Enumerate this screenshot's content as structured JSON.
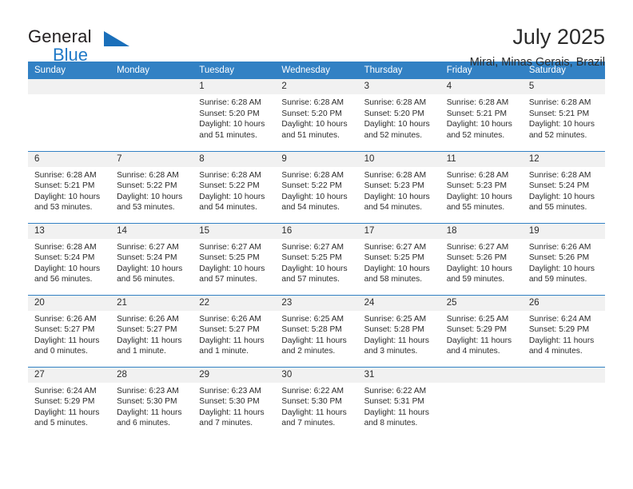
{
  "brand": {
    "name_part1": "General",
    "name_part2": "Blue",
    "triangle_color": "#1a6fba",
    "blue_text_color": "#2079c7"
  },
  "header": {
    "title": "July 2025",
    "subtitle": "Mirai, Minas Gerais, Brazil"
  },
  "theme": {
    "header_blue": "#3281c4",
    "daynum_band": "#f1f1f1",
    "text": "#2b2b2b"
  },
  "calendar": {
    "weekday_headers": [
      "Sunday",
      "Monday",
      "Tuesday",
      "Wednesday",
      "Thursday",
      "Friday",
      "Saturday"
    ],
    "weeks": [
      [
        {
          "day": "",
          "sunrise": "",
          "sunset": "",
          "daylight": ""
        },
        {
          "day": "",
          "sunrise": "",
          "sunset": "",
          "daylight": ""
        },
        {
          "day": "1",
          "sunrise": "Sunrise: 6:28 AM",
          "sunset": "Sunset: 5:20 PM",
          "daylight": "Daylight: 10 hours and 51 minutes."
        },
        {
          "day": "2",
          "sunrise": "Sunrise: 6:28 AM",
          "sunset": "Sunset: 5:20 PM",
          "daylight": "Daylight: 10 hours and 51 minutes."
        },
        {
          "day": "3",
          "sunrise": "Sunrise: 6:28 AM",
          "sunset": "Sunset: 5:20 PM",
          "daylight": "Daylight: 10 hours and 52 minutes."
        },
        {
          "day": "4",
          "sunrise": "Sunrise: 6:28 AM",
          "sunset": "Sunset: 5:21 PM",
          "daylight": "Daylight: 10 hours and 52 minutes."
        },
        {
          "day": "5",
          "sunrise": "Sunrise: 6:28 AM",
          "sunset": "Sunset: 5:21 PM",
          "daylight": "Daylight: 10 hours and 52 minutes."
        }
      ],
      [
        {
          "day": "6",
          "sunrise": "Sunrise: 6:28 AM",
          "sunset": "Sunset: 5:21 PM",
          "daylight": "Daylight: 10 hours and 53 minutes."
        },
        {
          "day": "7",
          "sunrise": "Sunrise: 6:28 AM",
          "sunset": "Sunset: 5:22 PM",
          "daylight": "Daylight: 10 hours and 53 minutes."
        },
        {
          "day": "8",
          "sunrise": "Sunrise: 6:28 AM",
          "sunset": "Sunset: 5:22 PM",
          "daylight": "Daylight: 10 hours and 54 minutes."
        },
        {
          "day": "9",
          "sunrise": "Sunrise: 6:28 AM",
          "sunset": "Sunset: 5:22 PM",
          "daylight": "Daylight: 10 hours and 54 minutes."
        },
        {
          "day": "10",
          "sunrise": "Sunrise: 6:28 AM",
          "sunset": "Sunset: 5:23 PM",
          "daylight": "Daylight: 10 hours and 54 minutes."
        },
        {
          "day": "11",
          "sunrise": "Sunrise: 6:28 AM",
          "sunset": "Sunset: 5:23 PM",
          "daylight": "Daylight: 10 hours and 55 minutes."
        },
        {
          "day": "12",
          "sunrise": "Sunrise: 6:28 AM",
          "sunset": "Sunset: 5:24 PM",
          "daylight": "Daylight: 10 hours and 55 minutes."
        }
      ],
      [
        {
          "day": "13",
          "sunrise": "Sunrise: 6:28 AM",
          "sunset": "Sunset: 5:24 PM",
          "daylight": "Daylight: 10 hours and 56 minutes."
        },
        {
          "day": "14",
          "sunrise": "Sunrise: 6:27 AM",
          "sunset": "Sunset: 5:24 PM",
          "daylight": "Daylight: 10 hours and 56 minutes."
        },
        {
          "day": "15",
          "sunrise": "Sunrise: 6:27 AM",
          "sunset": "Sunset: 5:25 PM",
          "daylight": "Daylight: 10 hours and 57 minutes."
        },
        {
          "day": "16",
          "sunrise": "Sunrise: 6:27 AM",
          "sunset": "Sunset: 5:25 PM",
          "daylight": "Daylight: 10 hours and 57 minutes."
        },
        {
          "day": "17",
          "sunrise": "Sunrise: 6:27 AM",
          "sunset": "Sunset: 5:25 PM",
          "daylight": "Daylight: 10 hours and 58 minutes."
        },
        {
          "day": "18",
          "sunrise": "Sunrise: 6:27 AM",
          "sunset": "Sunset: 5:26 PM",
          "daylight": "Daylight: 10 hours and 59 minutes."
        },
        {
          "day": "19",
          "sunrise": "Sunrise: 6:26 AM",
          "sunset": "Sunset: 5:26 PM",
          "daylight": "Daylight: 10 hours and 59 minutes."
        }
      ],
      [
        {
          "day": "20",
          "sunrise": "Sunrise: 6:26 AM",
          "sunset": "Sunset: 5:27 PM",
          "daylight": "Daylight: 11 hours and 0 minutes."
        },
        {
          "day": "21",
          "sunrise": "Sunrise: 6:26 AM",
          "sunset": "Sunset: 5:27 PM",
          "daylight": "Daylight: 11 hours and 1 minute."
        },
        {
          "day": "22",
          "sunrise": "Sunrise: 6:26 AM",
          "sunset": "Sunset: 5:27 PM",
          "daylight": "Daylight: 11 hours and 1 minute."
        },
        {
          "day": "23",
          "sunrise": "Sunrise: 6:25 AM",
          "sunset": "Sunset: 5:28 PM",
          "daylight": "Daylight: 11 hours and 2 minutes."
        },
        {
          "day": "24",
          "sunrise": "Sunrise: 6:25 AM",
          "sunset": "Sunset: 5:28 PM",
          "daylight": "Daylight: 11 hours and 3 minutes."
        },
        {
          "day": "25",
          "sunrise": "Sunrise: 6:25 AM",
          "sunset": "Sunset: 5:29 PM",
          "daylight": "Daylight: 11 hours and 4 minutes."
        },
        {
          "day": "26",
          "sunrise": "Sunrise: 6:24 AM",
          "sunset": "Sunset: 5:29 PM",
          "daylight": "Daylight: 11 hours and 4 minutes."
        }
      ],
      [
        {
          "day": "27",
          "sunrise": "Sunrise: 6:24 AM",
          "sunset": "Sunset: 5:29 PM",
          "daylight": "Daylight: 11 hours and 5 minutes."
        },
        {
          "day": "28",
          "sunrise": "Sunrise: 6:23 AM",
          "sunset": "Sunset: 5:30 PM",
          "daylight": "Daylight: 11 hours and 6 minutes."
        },
        {
          "day": "29",
          "sunrise": "Sunrise: 6:23 AM",
          "sunset": "Sunset: 5:30 PM",
          "daylight": "Daylight: 11 hours and 7 minutes."
        },
        {
          "day": "30",
          "sunrise": "Sunrise: 6:22 AM",
          "sunset": "Sunset: 5:30 PM",
          "daylight": "Daylight: 11 hours and 7 minutes."
        },
        {
          "day": "31",
          "sunrise": "Sunrise: 6:22 AM",
          "sunset": "Sunset: 5:31 PM",
          "daylight": "Daylight: 11 hours and 8 minutes."
        },
        {
          "day": "",
          "sunrise": "",
          "sunset": "",
          "daylight": ""
        },
        {
          "day": "",
          "sunrise": "",
          "sunset": "",
          "daylight": ""
        }
      ]
    ]
  }
}
